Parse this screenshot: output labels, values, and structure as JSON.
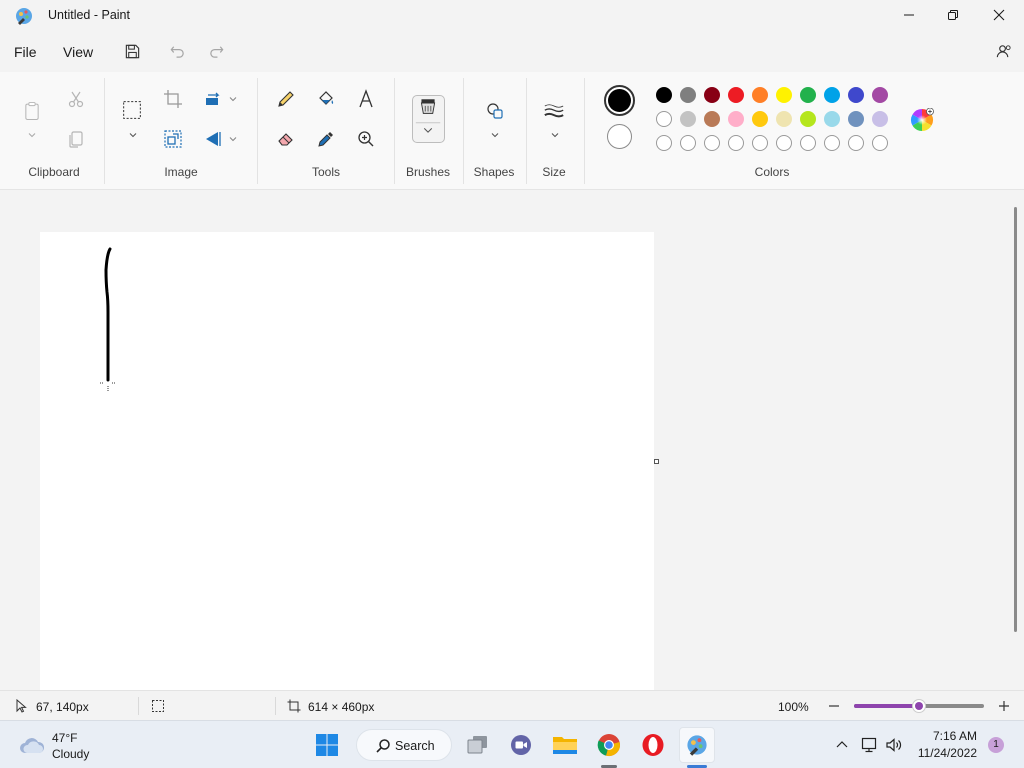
{
  "window": {
    "title": "Untitled - Paint"
  },
  "menu": {
    "file": "File",
    "view": "View"
  },
  "ribbon": {
    "groups": {
      "clipboard": "Clipboard",
      "image": "Image",
      "tools": "Tools",
      "brushes": "Brushes",
      "shapes": "Shapes",
      "size": "Size",
      "colors": "Colors"
    }
  },
  "colors": {
    "primary": "#000000",
    "secondary": "#ffffff",
    "accent": "#8e44ad",
    "row1": [
      "#000000",
      "#7f7f7f",
      "#880015",
      "#ed1c24",
      "#ff7f27",
      "#fff200",
      "#22b14c",
      "#00a2e8",
      "#3f48cc",
      "#a349a4"
    ],
    "row2": [
      "#ffffff",
      "#c3c3c3",
      "#b97a57",
      "#ffaec9",
      "#ffc90e",
      "#efe4b0",
      "#b5e61d",
      "#99d9ea",
      "#7092be",
      "#c8bfe7"
    ],
    "row3_empty_count": 10
  },
  "status": {
    "cursor_position": "67, 140px",
    "canvas_size": "614 × 460px",
    "zoom": "100%",
    "zoom_fraction": 0.5
  },
  "taskbar": {
    "weather_temp": "47°F",
    "weather_desc": "Cloudy",
    "search_label": "Search",
    "time": "7:16 AM",
    "date": "11/24/2022",
    "notification_count": "1"
  }
}
